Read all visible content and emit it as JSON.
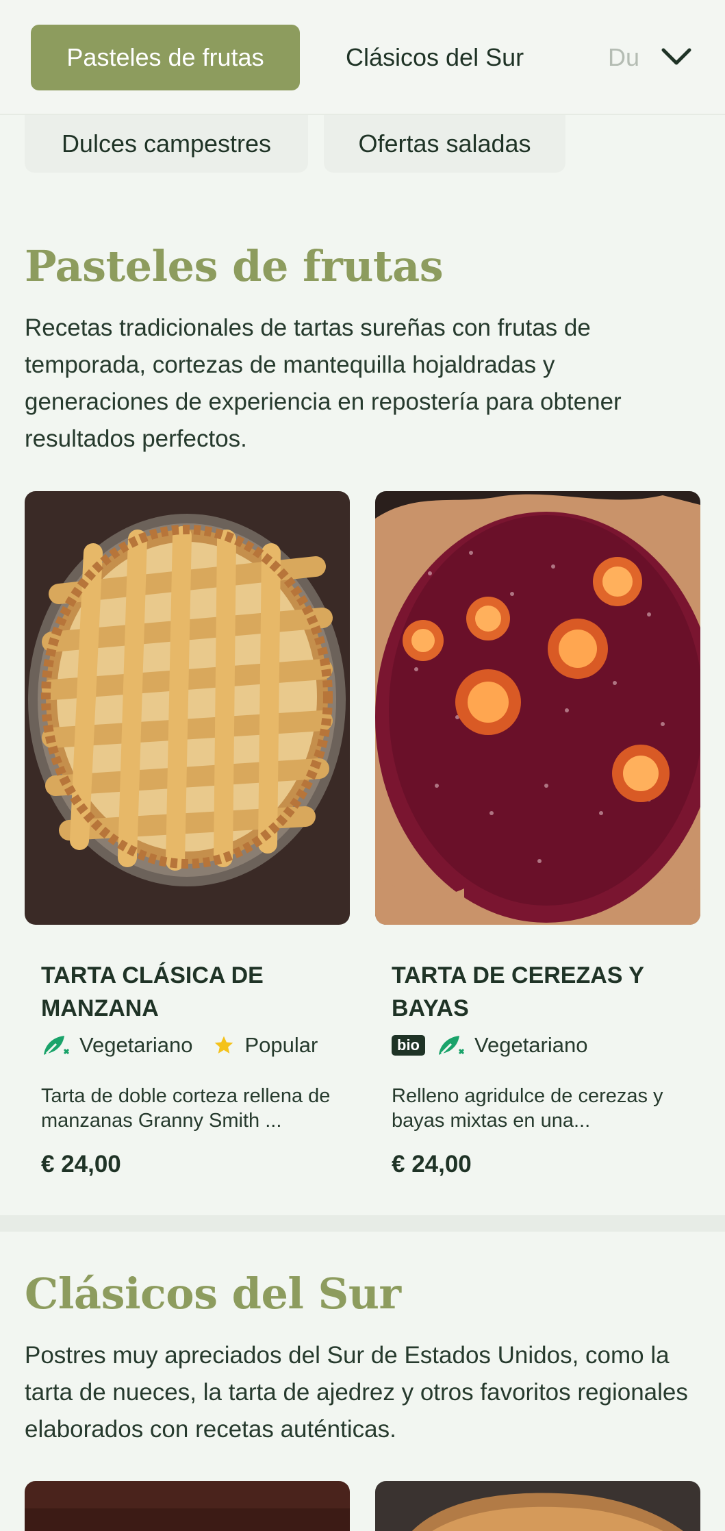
{
  "nav": {
    "tabs": [
      {
        "label": "Pasteles de frutas",
        "active": true
      },
      {
        "label": "Clásicos del Sur",
        "active": false
      },
      {
        "label": "Du",
        "active": false
      }
    ],
    "pills": [
      {
        "label": "Dulces campestres"
      },
      {
        "label": "Ofertas saladas"
      }
    ],
    "accent": "#8d9c5e"
  },
  "sections": [
    {
      "title": "Pasteles de frutas",
      "description": "Recetas tradicionales de tartas sureñas con frutas de temporada, cortezas de mantequilla hojaldradas y generaciones de experiencia en repostería para obtener resultados perfectos.",
      "products": [
        {
          "name": "TARTA CLÁSICA DE MANZANA",
          "tags": [
            "Vegetariano",
            "Popular"
          ],
          "description": "Tarta de doble corteza rellena de manzanas Granny Smith ...",
          "price": "€ 24,00"
        },
        {
          "name": "TARTA DE CEREZAS Y BAYAS",
          "badge": "bio",
          "tags": [
            "Vegetariano"
          ],
          "description": "Relleno agridulce de cerezas y bayas mixtas en una...",
          "price": "€ 24,00"
        }
      ]
    },
    {
      "title": "Clásicos del Sur",
      "description": "Postres muy apreciados del Sur de Estados Unidos, como la tarta de nueces, la tarta de ajedrez y otros favoritos regionales elaborados con recetas auténticas."
    }
  ]
}
